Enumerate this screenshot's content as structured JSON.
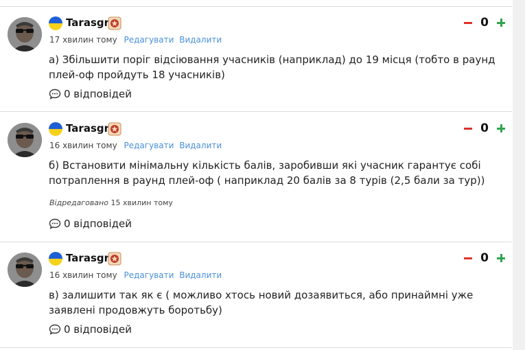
{
  "colors": {
    "link": "#4a90d9",
    "downvote": "#e0312b",
    "upvote": "#2ea44f",
    "flag_blue": "#1f5fd6",
    "flag_yellow": "#f7d21a"
  },
  "icons": {
    "flag": "ukraine-flag-icon",
    "badge": "rank-badge-icon",
    "reply": "speech-bubble-icon"
  },
  "comments": [
    {
      "username": "Tarasgr",
      "time": "17 хвилин тому",
      "edit_label": "Редагувати",
      "delete_label": "Видалити",
      "text": "а) Збільшити поріг відсіювання учасників (наприклад) до 19 місця (тобто в раунд плей-оф пройдуть 18 учасників)",
      "score": "0",
      "replies": "0 відповідей"
    },
    {
      "username": "Tarasgr",
      "time": "16 хвилин тому",
      "edit_label": "Редагувати",
      "delete_label": "Видалити",
      "text": "б) Встановити мінімальну кількість балів, заробивши які учасник гарантує собі потраплення в раунд плей-оф ( наприклад 20 балів  за 8 турів (2,5 бали за тур))",
      "edited_label": "Відредаговано",
      "edited_time": "15 хвилин тому",
      "score": "0",
      "replies": "0 відповідей"
    },
    {
      "username": "Tarasgr",
      "time": "16 хвилин тому",
      "edit_label": "Редагувати",
      "delete_label": "Видалити",
      "text": "в) залишити так як є ( можливо хтось новий дозаявиться, або принаймні уже заявлені продовжуть боротьбу)",
      "score": "0",
      "replies": "0 відповідей"
    }
  ]
}
